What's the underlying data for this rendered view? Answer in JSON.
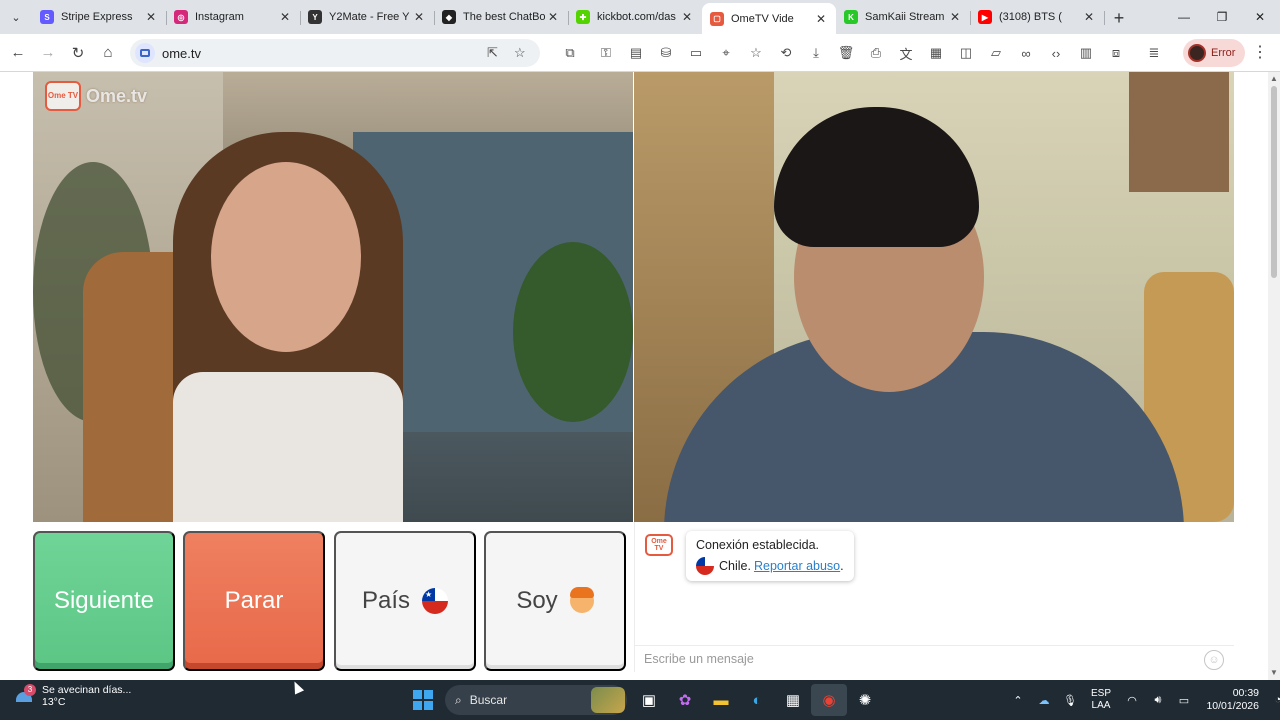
{
  "browser": {
    "tabs": [
      {
        "title": "Stripe Express",
        "color": "#635bff",
        "glyph": "S"
      },
      {
        "title": "Instagram",
        "color": "#d6287a",
        "glyph": "◎"
      },
      {
        "title": "Y2Mate - Free Y",
        "color": "#333333",
        "glyph": "Y"
      },
      {
        "title": "The best ChatBo",
        "color": "#222222",
        "glyph": "◆"
      },
      {
        "title": "kickbot.com/das",
        "color": "#53d300",
        "glyph": "✚"
      },
      {
        "title": "OmeTV Vide",
        "color": "#e65a3f",
        "glyph": "▢"
      },
      {
        "title": "SamKaii Stream",
        "color": "#28c828",
        "glyph": "K"
      },
      {
        "title": "(3108) BTS (",
        "color": "#ff0000",
        "glyph": "▶"
      }
    ],
    "url": "ome.tv",
    "error_label": "Error"
  },
  "app": {
    "logo_text": "Ome.tv",
    "logo_badge": "Ome TV",
    "buttons": {
      "next": "Siguiente",
      "stop": "Parar",
      "country": "País",
      "soy": "Soy"
    },
    "chat": {
      "line1": "Conexión establecida.",
      "country": "Chile.",
      "report_link": "Reportar abuso",
      "placeholder": "Escribe un mensaje"
    }
  },
  "taskbar": {
    "weather_title": "Se avecinan días...",
    "weather_temp": "13°C",
    "weather_badge": "3",
    "search_placeholder": "Buscar",
    "lang_line1": "ESP",
    "lang_line2": "LAA",
    "time": "00:39",
    "date": "10/01/2026"
  }
}
